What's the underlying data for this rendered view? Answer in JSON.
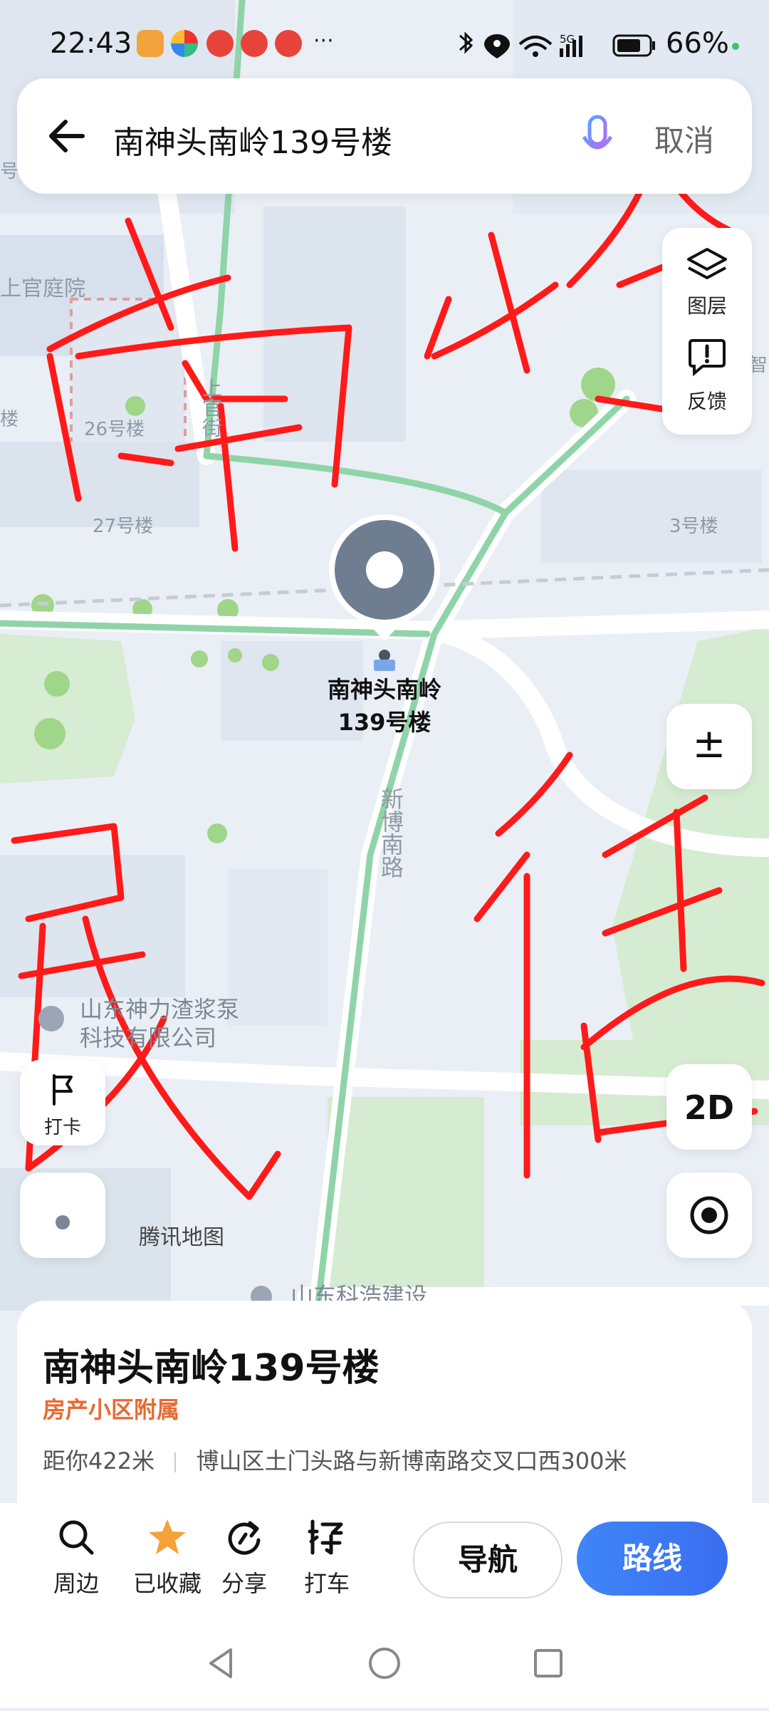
{
  "status_bar": {
    "time": "22:43",
    "dots": "···",
    "battery": "66%"
  },
  "search": {
    "query": "南神头南岭139号楼",
    "cancel_label": "取消"
  },
  "map_controls": {
    "layers_label": "图层",
    "feedback_label": "反馈",
    "zoom_label": "±",
    "mode_2d_label": "2D",
    "checkin_label": "打卡"
  },
  "map_labels": {
    "shangguan_court": "上官庭院",
    "building_26": "26号楼",
    "building_27": "27号楼",
    "building_3": "3号楼",
    "lou_left": "楼",
    "street_shangguan": "上官街",
    "road_xinbo": "新博南路",
    "company_1_line1": "山东神力渣浆泵",
    "company_1_line2": "科技有限公司",
    "company_2": "山东科浩建设",
    "map_brand": "腾讯地图",
    "top_left_fragment": "号",
    "right_fragment": "智"
  },
  "poi": {
    "line1": "南神头南岭",
    "line2": "139号楼"
  },
  "handwriting": {
    "chars": [
      "南",
      "岭",
      "民",
      "街"
    ]
  },
  "place_card": {
    "title": "南神头南岭139号楼",
    "category": "房产小区附属",
    "distance": "距你422米",
    "address": "博山区土门头路与新博南路交叉口西300米"
  },
  "toolbar": {
    "nearby": "周边",
    "saved": "已收藏",
    "share": "分享",
    "taxi": "打车",
    "navigate": "导航",
    "route": "路线"
  },
  "colors": {
    "route_blue": "#3a7cf0",
    "category_orange": "#e86a33",
    "handwriting_red": "#ff1a1a",
    "road_green": "#8fd4a8",
    "star_orange": "#f5a13a"
  }
}
